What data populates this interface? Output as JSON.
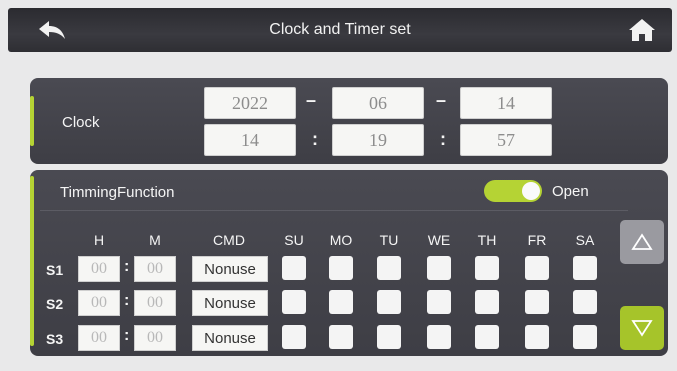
{
  "header": {
    "title": "Clock and Timer set",
    "back_icon": "back-arrow-icon",
    "home_icon": "home-icon"
  },
  "clock": {
    "label": "Clock",
    "date": {
      "year": "2022",
      "month": "06",
      "day": "14"
    },
    "time": {
      "hour": "14",
      "minute": "19",
      "second": "57"
    },
    "date_sep": "–",
    "time_sep": ":"
  },
  "timer": {
    "label": "TimmingFunction",
    "toggle_state": "on",
    "toggle_label": "Open",
    "columns": [
      "H",
      "M",
      "CMD",
      "SU",
      "MO",
      "TU",
      "WE",
      "TH",
      "FR",
      "SA"
    ],
    "rows": [
      {
        "label": "S1",
        "hour": "00",
        "minute": "00",
        "cmd": "Nonuse"
      },
      {
        "label": "S2",
        "hour": "00",
        "minute": "00",
        "cmd": "Nonuse"
      },
      {
        "label": "S3",
        "hour": "00",
        "minute": "00",
        "cmd": "Nonuse"
      }
    ],
    "colon": ":"
  },
  "colors": {
    "accent": "#b5d334",
    "panel": "#45454c",
    "header": "#303035"
  }
}
